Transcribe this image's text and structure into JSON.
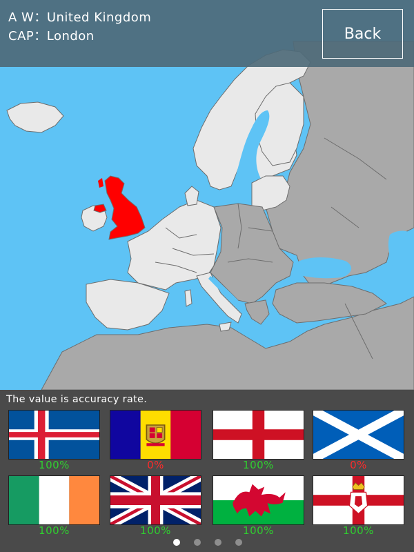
{
  "header": {
    "line1": "A W：United Kingdom",
    "line2": "CAP：London",
    "back_label": "Back"
  },
  "map": {
    "highlighted_country": "United Kingdom",
    "colors": {
      "sea": "#5ec3f5",
      "land_active": "#e9e9e9",
      "land_inactive": "#a9a9a9",
      "highlight": "#ff0000",
      "border": "#6d6d6d"
    }
  },
  "bottom": {
    "note": "The value is accuracy rate.",
    "flags": [
      {
        "icon": "iceland-flag-icon",
        "pct": "100%",
        "status": "good"
      },
      {
        "icon": "andorra-flag-icon",
        "pct": "0%",
        "status": "bad"
      },
      {
        "icon": "england-flag-icon",
        "pct": "100%",
        "status": "good"
      },
      {
        "icon": "scotland-flag-icon",
        "pct": "0%",
        "status": "bad"
      },
      {
        "icon": "ireland-flag-icon",
        "pct": "100%",
        "status": "good"
      },
      {
        "icon": "united-kingdom-flag-icon",
        "pct": "100%",
        "status": "good"
      },
      {
        "icon": "wales-flag-icon",
        "pct": "100%",
        "status": "good"
      },
      {
        "icon": "northern-ireland-flag-icon",
        "pct": "100%",
        "status": "good"
      }
    ],
    "pager": {
      "pages": 4,
      "current": 1
    }
  }
}
